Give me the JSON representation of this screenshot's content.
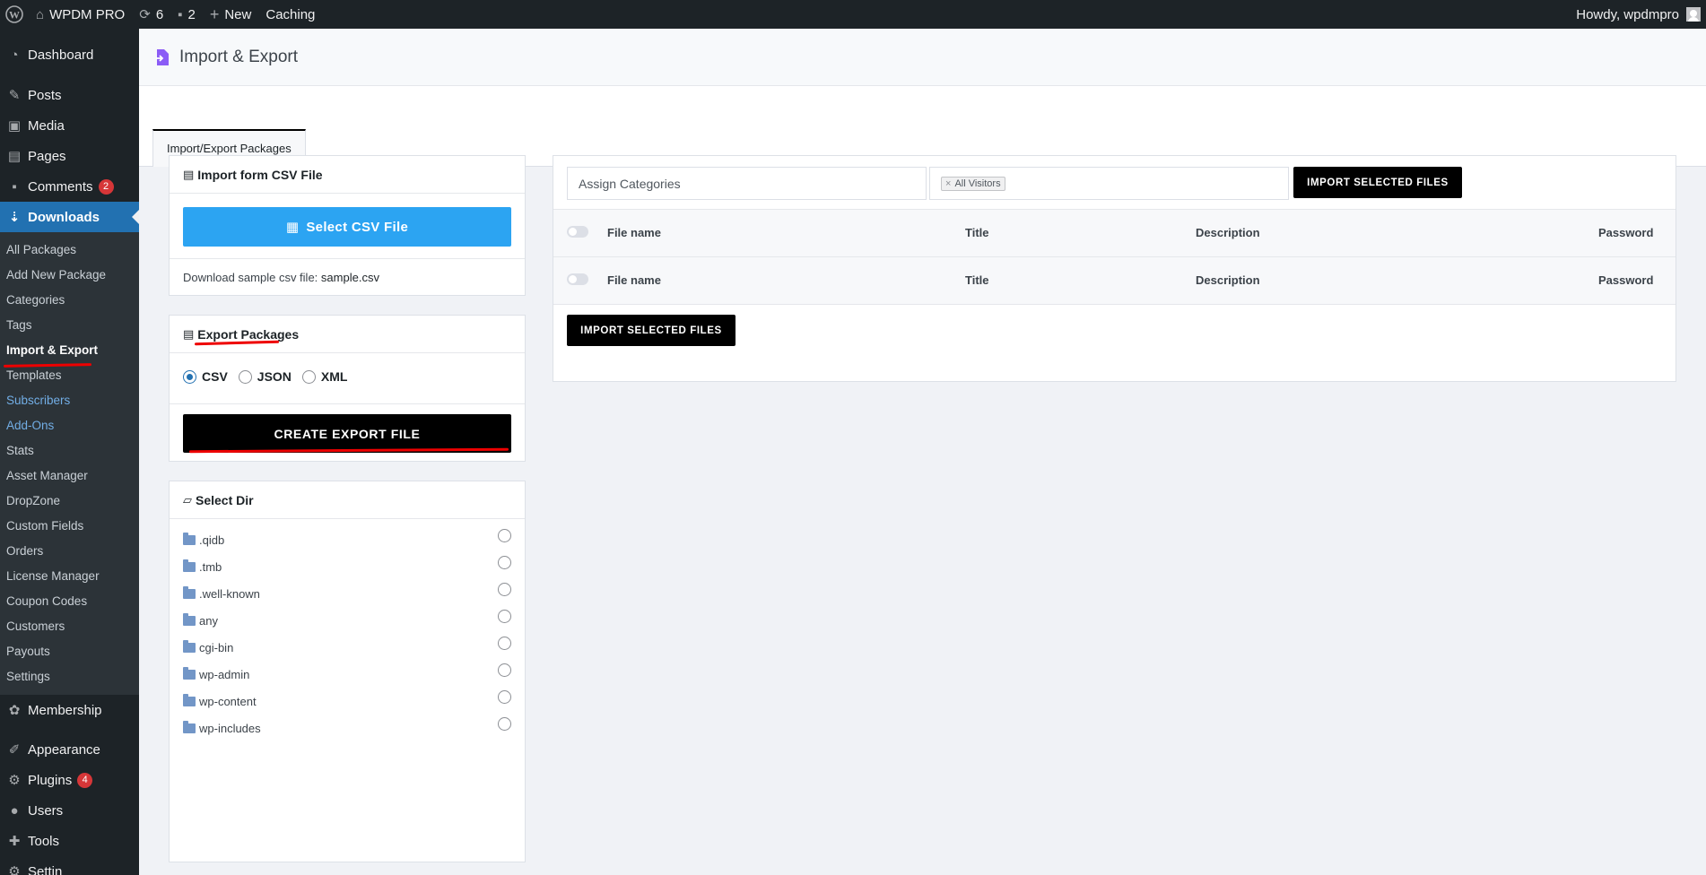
{
  "adminbar": {
    "site_name": "WPDM PRO",
    "updates_count": "6",
    "comments_count": "2",
    "new_label": "New",
    "caching_label": "Caching",
    "howdy": "Howdy, wpdmpro"
  },
  "sidebar": {
    "dashboard": "Dashboard",
    "posts": "Posts",
    "media": "Media",
    "pages": "Pages",
    "comments": "Comments",
    "comments_badge": "2",
    "downloads": "Downloads",
    "submenu": [
      "All Packages",
      "Add New Package",
      "Categories",
      "Tags",
      "Import & Export",
      "Templates",
      "Subscribers",
      "Add-Ons",
      "Stats",
      "Asset Manager",
      "DropZone",
      "Custom Fields",
      "Orders",
      "License Manager",
      "Coupon Codes",
      "Customers",
      "Payouts",
      "Settings"
    ],
    "membership": "Membership",
    "appearance": "Appearance",
    "plugins": "Plugins",
    "plugins_badge": "4",
    "users": "Users",
    "tools": "Tools",
    "settings_partial": "Settin"
  },
  "page": {
    "title": "Import & Export",
    "tab": "Import/Export Packages"
  },
  "import_panel": {
    "title": "Import form CSV File",
    "select_button": "Select CSV File",
    "sample_prefix": "Download sample csv file:",
    "sample_link": "sample.csv"
  },
  "export_panel": {
    "title": "Export Packages",
    "formats": [
      "CSV",
      "JSON",
      "XML"
    ],
    "selected_format": "CSV",
    "create_button": "CREATE EXPORT FILE"
  },
  "dir_panel": {
    "title": "Select Dir",
    "dirs": [
      ".qidb",
      ".tmb",
      ".well-known",
      "any",
      "cgi-bin",
      "wp-admin",
      "wp-content",
      "wp-includes"
    ]
  },
  "right_panel": {
    "categories_placeholder": "Assign Categories",
    "access_tag": "All Visitors",
    "import_button": "IMPORT SELECTED FILES",
    "columns": [
      "File name",
      "Title",
      "Description",
      "Password"
    ],
    "rows": [
      {
        "file": "File name",
        "title": "Title",
        "description": "Description",
        "password": "Password"
      },
      {
        "file": "File name",
        "title": "Title",
        "description": "Description",
        "password": "Password"
      }
    ],
    "import_button_bottom": "IMPORT SELECTED FILES"
  },
  "colors": {
    "adminbar_bg": "#1d2327",
    "active_menu": "#2271b1",
    "select_button": "#2ca4f2",
    "annotation_red": "#e00000"
  }
}
